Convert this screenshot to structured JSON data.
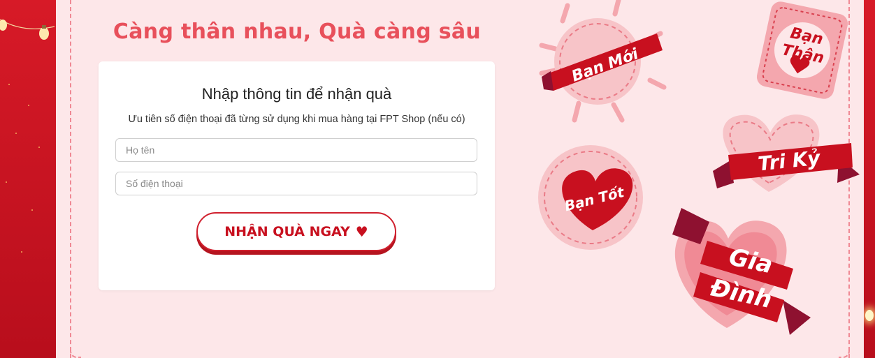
{
  "page": {
    "headline": "Càng thân nhau, Quà càng sâu"
  },
  "form": {
    "title": "Nhập thông tin để nhận quà",
    "subtitle": "Ưu tiên số điện thoại đã từng sử dụng khi mua hàng tại FPT Shop (nếu có)",
    "name_field": {
      "value": "",
      "placeholder": "Họ tên"
    },
    "phone_field": {
      "value": "",
      "placeholder": "Số điện thoại"
    },
    "submit_label": "NHẬN QUÀ NGAY",
    "submit_icon": "heart-icon"
  },
  "stickers": {
    "ban_moi": "Bạn Mới",
    "ban_than_line1": "Bạn",
    "ban_than_line2": "Thân",
    "tri_ky": "Tri Kỷ",
    "ban_tot": "Bạn Tốt",
    "gia_dinh_line1": "Gia",
    "gia_dinh_line2": "Đình"
  },
  "colors": {
    "brand_red": "#c8101f",
    "headline_coral": "#e8505b",
    "panel_pink": "#fde7e9",
    "sticker_pink": "#f7c4c8"
  }
}
